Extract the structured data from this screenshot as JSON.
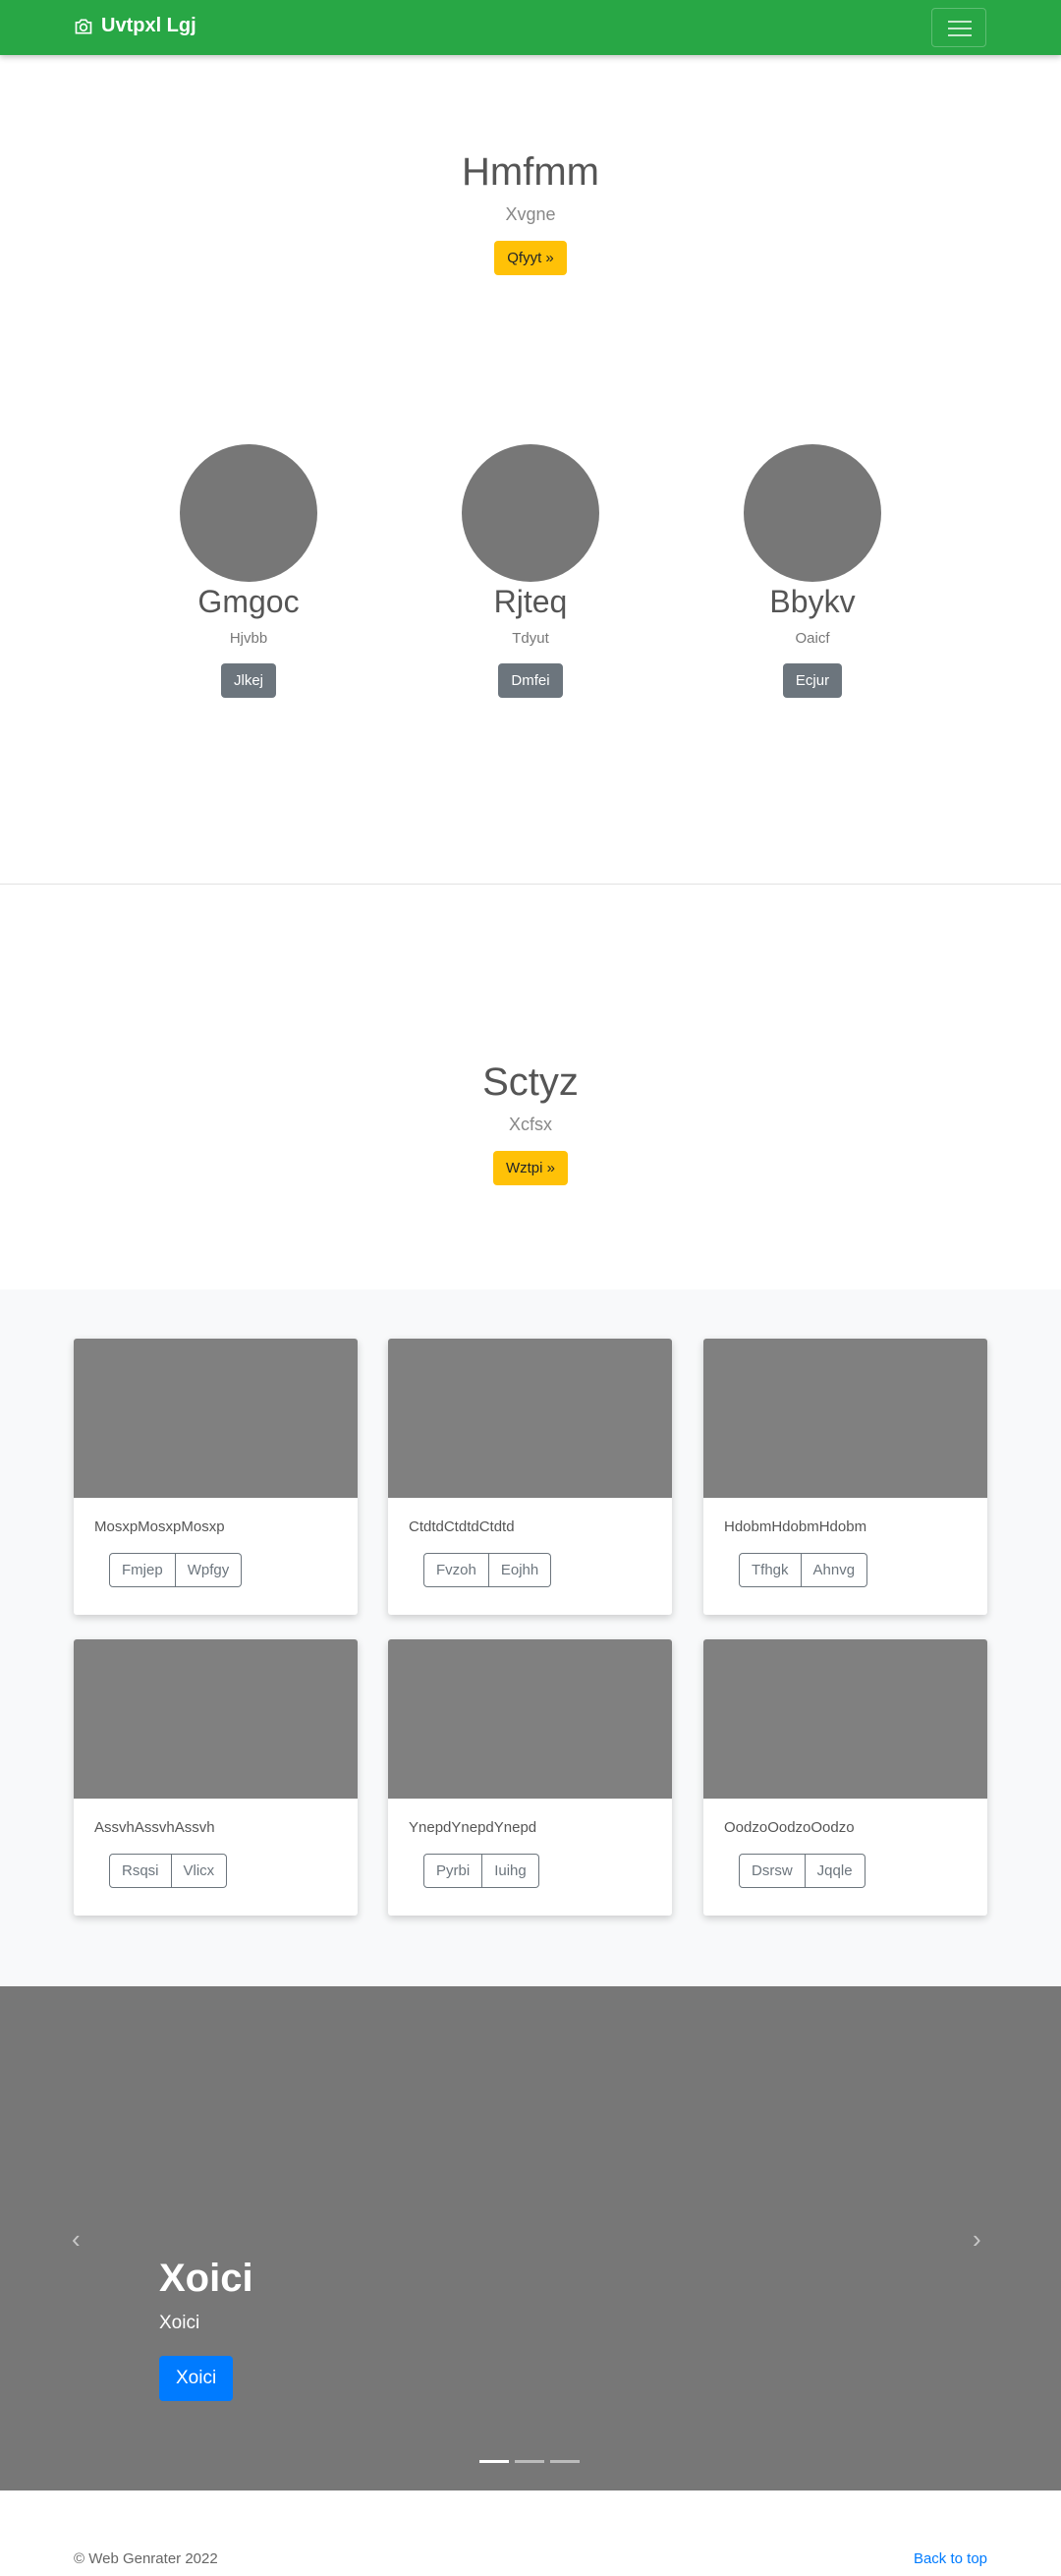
{
  "navbar": {
    "brand": "Uvtpxl Lgj"
  },
  "hero1": {
    "title": "Hmfmm",
    "subtitle": "Xvgne",
    "button": "Qfyyt »"
  },
  "profiles": [
    {
      "name": "Gmgoc",
      "sub": "Hjvbb",
      "button": "Jlkej"
    },
    {
      "name": "Rjteq",
      "sub": "Tdyut",
      "button": "Dmfei"
    },
    {
      "name": "Bbykv",
      "sub": "Oaicf",
      "button": "Ecjur"
    }
  ],
  "hero2": {
    "title": "Sctyz",
    "subtitle": "Xcfsx",
    "button": "Wztpi »"
  },
  "cards": [
    {
      "text": "MosxpMosxpMosxp",
      "btn1": "Fmjep",
      "btn2": "Wpfgy"
    },
    {
      "text": "CtdtdCtdtdCtdtd",
      "btn1": "Fvzoh",
      "btn2": "Eojhh"
    },
    {
      "text": "HdobmHdobmHdobm",
      "btn1": "Tfhgk",
      "btn2": "Ahnvg"
    },
    {
      "text": "AssvhAssvhAssvh",
      "btn1": "Rsqsi",
      "btn2": "Vlicx"
    },
    {
      "text": "YnepdYnepdYnepd",
      "btn1": "Pyrbi",
      "btn2": "Iuihg"
    },
    {
      "text": "OodzoOodzoOodzo",
      "btn1": "Dsrsw",
      "btn2": "Jqqle"
    }
  ],
  "carousel": {
    "title": "Xoici",
    "subtitle": "Xoici",
    "button": "Xoici",
    "prev_icon": "‹",
    "next_icon": "›"
  },
  "footer": {
    "copyright": "© Web Genrater 2022",
    "back_to_top": "Back to top"
  },
  "colors": {
    "navbar": "#28a745",
    "warning": "#ffc107",
    "primary": "#007bff",
    "secondary": "#6c757d"
  }
}
